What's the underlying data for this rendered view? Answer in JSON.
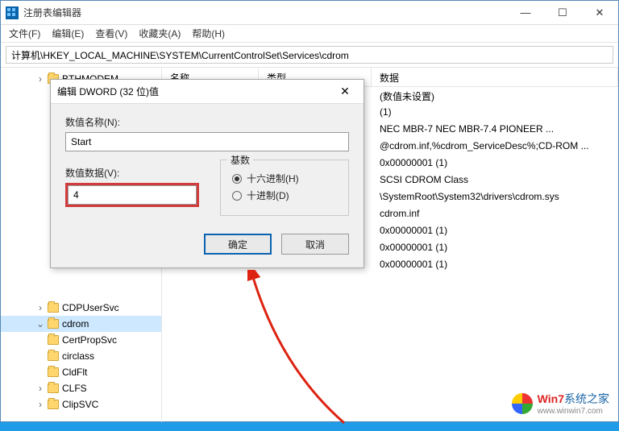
{
  "window": {
    "title": "注册表编辑器",
    "controls": {
      "min": "—",
      "max": "☐",
      "close": "✕"
    }
  },
  "menu": [
    "文件(F)",
    "编辑(E)",
    "查看(V)",
    "收藏夹(A)",
    "帮助(H)"
  ],
  "address": "计算机\\HKEY_LOCAL_MACHINE\\SYSTEM\\CurrentControlSet\\Services\\cdrom",
  "tree": [
    {
      "label": "BTHMODEM",
      "chev": ">"
    },
    {
      "label": "CDPUserSvc",
      "chev": ">"
    },
    {
      "label": "cdrom",
      "chev": "v",
      "sel": true
    },
    {
      "label": "CertPropSvc",
      "chev": ""
    },
    {
      "label": "circlass",
      "chev": ""
    },
    {
      "label": "CldFlt",
      "chev": ""
    },
    {
      "label": "CLFS",
      "chev": ">"
    },
    {
      "label": "ClipSVC",
      "chev": ">"
    }
  ],
  "list": {
    "headers": {
      "name": "名称",
      "type": "类型",
      "data": "数据"
    },
    "rows": [
      "(数值未设置)",
      "(1)",
      "NEC     MBR-7    NEC     MBR-7.4  PIONEER ...",
      "@cdrom.inf,%cdrom_ServiceDesc%;CD-ROM ...",
      "0x00000001 (1)",
      "SCSI CDROM Class",
      "\\SystemRoot\\System32\\drivers\\cdrom.sys",
      "cdrom.inf",
      "0x00000001 (1)",
      "0x00000001 (1)",
      "0x00000001 (1)"
    ]
  },
  "dialog": {
    "title": "编辑 DWORD (32 位)值",
    "name_label": "数值名称(N):",
    "name_value": "Start",
    "value_label": "数值数据(V):",
    "value": "4",
    "base_label": "基数",
    "radio_hex": "十六进制(H)",
    "radio_dec": "十进制(D)",
    "ok": "确定",
    "cancel": "取消"
  },
  "watermark": {
    "brand": "Win7",
    "text": "系统之家",
    "url": "www.winwin7.com"
  }
}
